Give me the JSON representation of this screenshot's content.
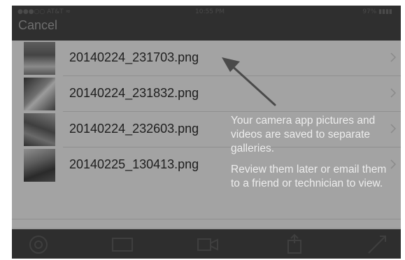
{
  "status_bar": {
    "carrier": "●●●○○ AT&T ≈",
    "time": "10:55 PM",
    "battery": "97% ▮▮▮▮"
  },
  "nav": {
    "cancel_label": "Cancel"
  },
  "files": [
    {
      "name": "20140224_231703.png",
      "thumb_icon": "photo-thumbnail"
    },
    {
      "name": "20140224_231832.png",
      "thumb_icon": "photo-thumbnail"
    },
    {
      "name": "20140224_232603.png",
      "thumb_icon": "photo-thumbnail"
    },
    {
      "name": "20140225_130413.png",
      "thumb_icon": "photo-thumbnail"
    }
  ],
  "hint": {
    "line1": "Your camera app pictures and videos are saved to separate galleries.",
    "line2": "Review them later or email them to a friend or technician to view."
  },
  "toolbar": {
    "icons": [
      "camera-shutter-icon",
      "gallery-icon",
      "video-icon",
      "upload-icon",
      "tools-icon"
    ]
  },
  "colors": {
    "overlay": "#9a9a9a",
    "topbar": "#2f2f2f",
    "toolbar": "#2e2e2e",
    "hint_text": "#ededed",
    "file_text": "#1e1e1e"
  }
}
